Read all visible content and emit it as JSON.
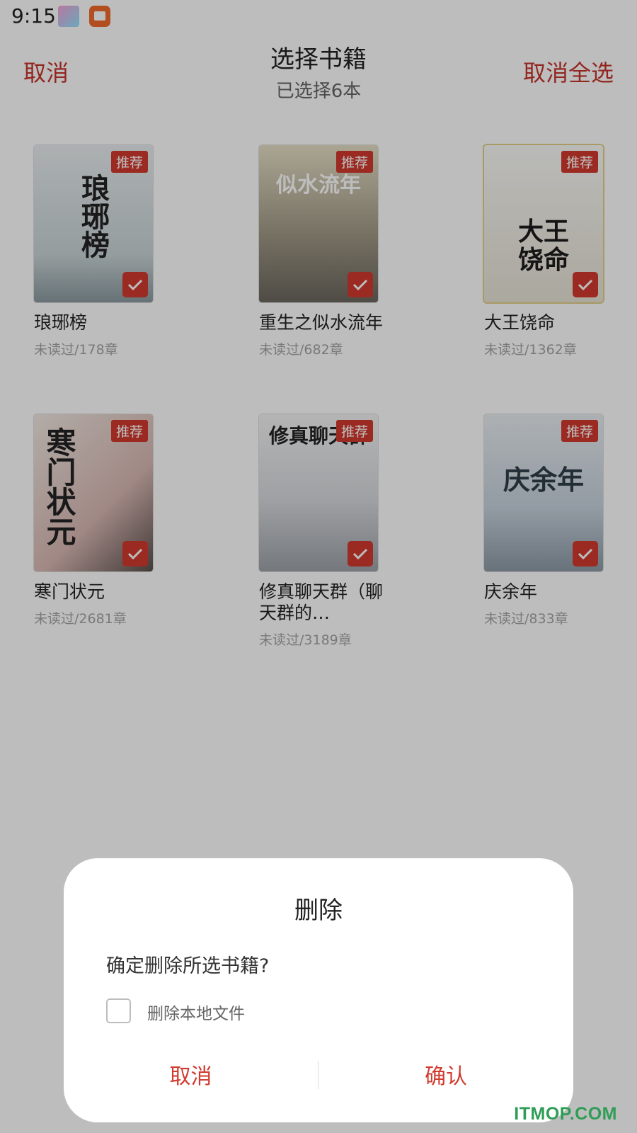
{
  "status_bar": {
    "time": "9:15"
  },
  "header": {
    "cancel_label": "取消",
    "title": "选择书籍",
    "subtitle": "已选择6本",
    "deselect_all_label": "取消全选"
  },
  "books": [
    {
      "title": "琅琊榜",
      "meta": "未读过/178章",
      "badge": "推荐",
      "cover_text": "琅琊榜"
    },
    {
      "title": "重生之似水流年",
      "meta": "未读过/682章",
      "badge": "推荐",
      "cover_text": "似水流年"
    },
    {
      "title": "大王饶命",
      "meta": "未读过/1362章",
      "badge": "推荐",
      "cover_text": "大王饶命"
    },
    {
      "title": "寒门状元",
      "meta": "未读过/2681章",
      "badge": "推荐",
      "cover_text": "寒门状元"
    },
    {
      "title": "修真聊天群（聊天群的…",
      "meta": "未读过/3189章",
      "badge": "推荐",
      "cover_text": "修真聊天群"
    },
    {
      "title": "庆余年",
      "meta": "未读过/833章",
      "badge": "推荐",
      "cover_text": "庆余年"
    }
  ],
  "dialog": {
    "title": "删除",
    "message": "确定删除所选书籍?",
    "checkbox_label": "删除本地文件",
    "cancel_label": "取消",
    "confirm_label": "确认"
  },
  "watermark": "ITMOP.COM",
  "colors": {
    "accent": "#d23a2e",
    "scrim": "rgba(0,0,0,0.26)"
  }
}
